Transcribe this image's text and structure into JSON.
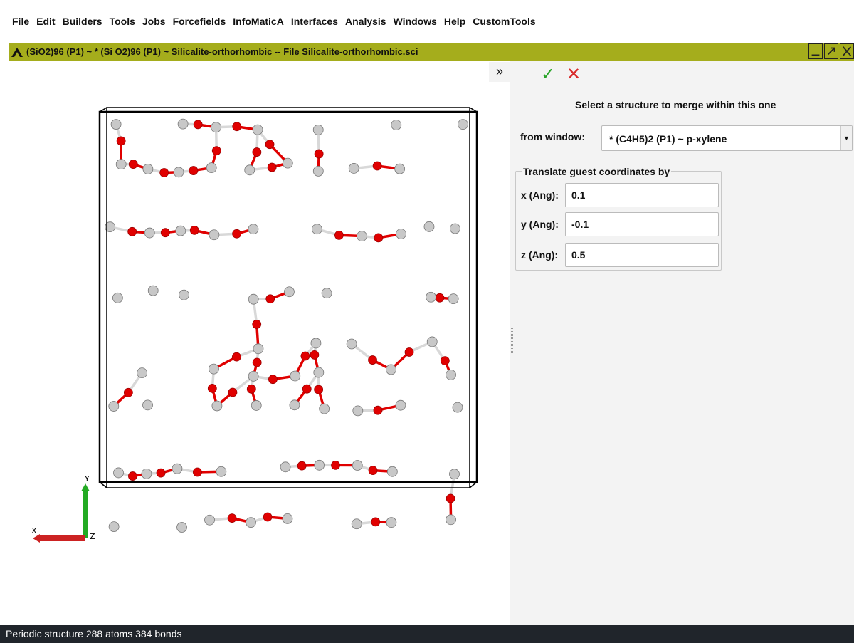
{
  "menu": [
    "File",
    "Edit",
    "Builders",
    "Tools",
    "Jobs",
    "Forcefields",
    "InfoMaticA",
    "Interfaces",
    "Analysis",
    "Windows",
    "Help",
    "CustomTools"
  ],
  "window": {
    "title": "(SiO2)96  (P1) ~ * (Si O2)96  (P1) ~ Silicalite-orthorhombic -- File Silicalite-orthorhombic.sci",
    "controls": [
      "minimize-icon",
      "undock-icon",
      "close-icon"
    ]
  },
  "viewer": {
    "axes": {
      "y": "Y",
      "x": "X",
      "z": "Z"
    },
    "colors": {
      "oxygen": "#e00000",
      "silicon": "#c8c8c8",
      "cell": "#000000",
      "x_axis": "#cc2222",
      "y_axis": "#22aa22"
    }
  },
  "panel": {
    "expand_icon": "»",
    "accept_icon": "✓",
    "cancel_icon": "✕",
    "title": "Select a structure to merge within this one",
    "from_window_label": "from window:",
    "from_window_value": "* (C4H5)2  (P1) ~ p-xylene",
    "translate_legend": "Translate guest coordinates by",
    "x_label": "x (Ang):",
    "x_value": "0.1",
    "y_label": "y (Ang):",
    "y_value": "-0.1",
    "z_label": "z (Ang):",
    "z_value": "0.5"
  },
  "status": "Periodic structure  288 atoms  384 bonds"
}
